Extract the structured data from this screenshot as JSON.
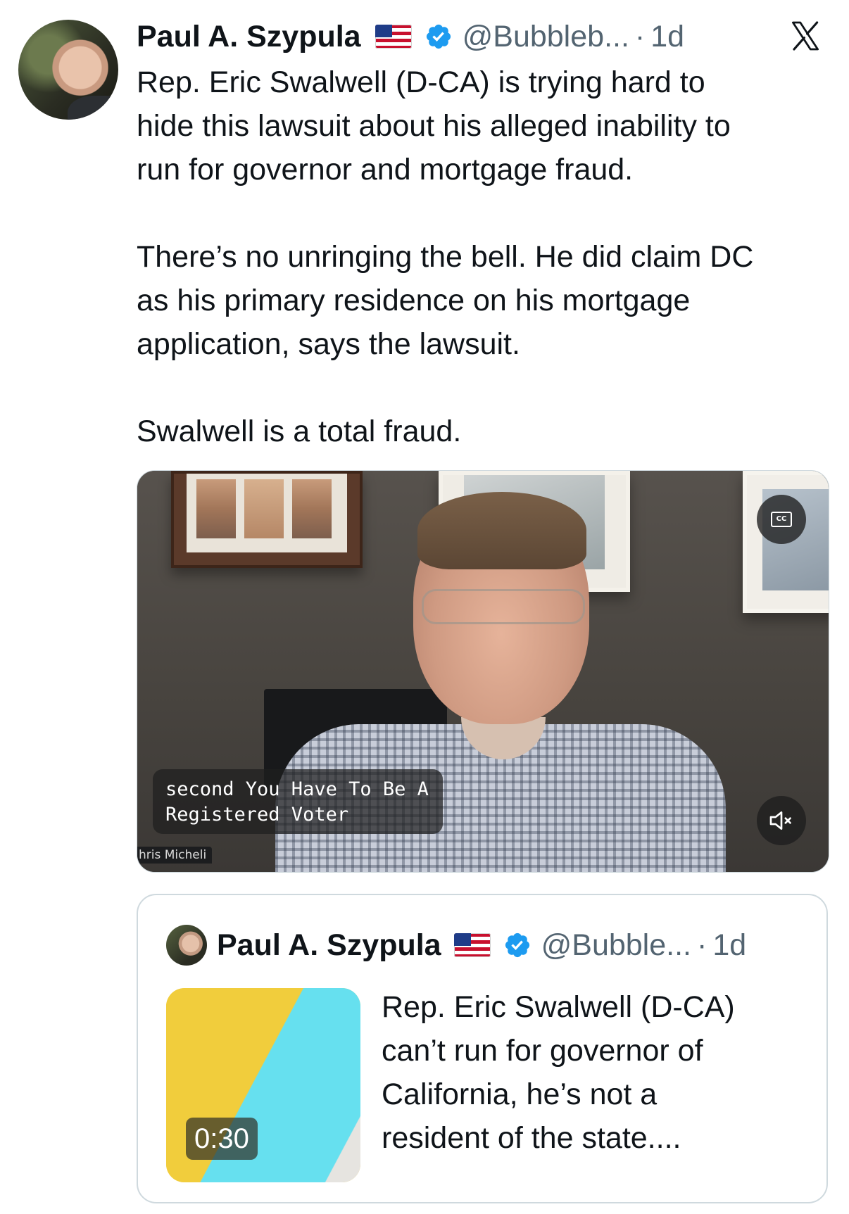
{
  "tweet": {
    "author": {
      "display_name": "Paul A. Szypula",
      "flag_icon": "us-flag-icon",
      "verified_icon": "verified-badge-icon",
      "handle": "@Bubbleb...",
      "separator": "·",
      "time": "1d"
    },
    "app_logo_icon": "x-logo-icon",
    "text_paragraphs": [
      "Rep. Eric Swalwell (D-CA) is trying hard to\nhide this lawsuit about his alleged inability to\nrun for governor and mortgage fraud.",
      "There’s no unringing the bell. He did claim DC\nas his primary residence on his mortgage\napplication, says the lawsuit.",
      "Swalwell is a total fraud."
    ],
    "video": {
      "caption_lines": [
        "second You Have To Be A",
        "Registered Voter"
      ],
      "name_tag": "hris Micheli",
      "cc_label": "CC",
      "cc_icon": "closed-captions-icon",
      "mute_icon": "speaker-muted-icon"
    }
  },
  "quoted_tweet": {
    "author": {
      "display_name": "Paul A. Szypula",
      "flag_icon": "us-flag-icon",
      "verified_icon": "verified-badge-icon",
      "handle": "@Bubble...",
      "separator": "·",
      "time": "1d"
    },
    "thumbnail": {
      "duration": "0:30"
    },
    "text": "Rep. Eric Swalwell (D-CA)\ncan’t run for governor of\nCalifornia, he’s not a\nresident of the state...."
  },
  "colors": {
    "text_primary": "#0f1419",
    "text_secondary": "#536471",
    "verified_blue": "#1d9bf0",
    "border": "#cfd9de"
  }
}
